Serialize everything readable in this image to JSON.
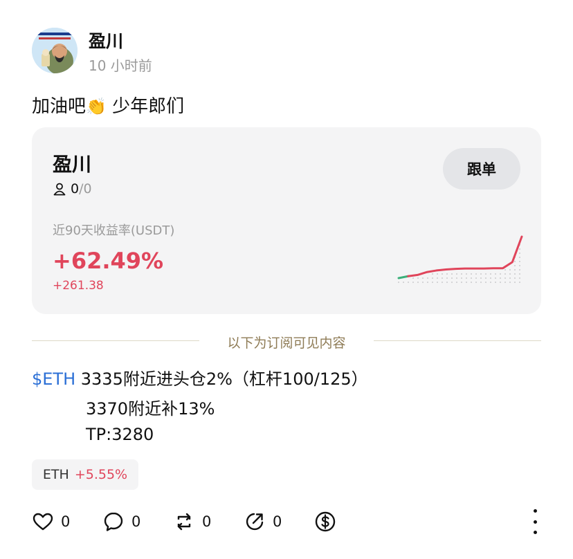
{
  "post": {
    "author": "盈川",
    "time": "10 小时前",
    "text": "加油吧",
    "clap_emoji": "👏",
    "text_after": " 少年郎们"
  },
  "card": {
    "name": "盈川",
    "followers_current": "0",
    "followers_sep": "/",
    "followers_max": "0",
    "follow_label": "跟单",
    "roi_label": "近90天收益率(USDT)",
    "roi_pct": "+62.49%",
    "roi_abs": "+261.38",
    "sparkline": [
      0.0,
      0.6,
      1.0,
      1.9,
      2.4,
      2.7,
      2.9,
      3.0,
      3.0,
      3.0,
      3.1,
      3.1,
      5.0,
      13.0
    ]
  },
  "divider": {
    "label": "以下为订阅可见内容"
  },
  "content": {
    "ticker": "$ETH",
    "line1": " 3335附近进头仓2%（杠杆100/125）",
    "line2": "3370附近补13%",
    "line3": "TP:3280"
  },
  "coin_tag": {
    "symbol": "ETH",
    "change": "+5.55%"
  },
  "actions": {
    "like_count": "0",
    "comment_count": "0",
    "repost_count": "0",
    "share_count": "0",
    "tip_icon": "dollar-circle-icon"
  },
  "colors": {
    "up": "#e0455b",
    "ticker": "#2b6fd6",
    "card_bg": "#f4f4f5",
    "divider_text": "#8e7b55"
  }
}
